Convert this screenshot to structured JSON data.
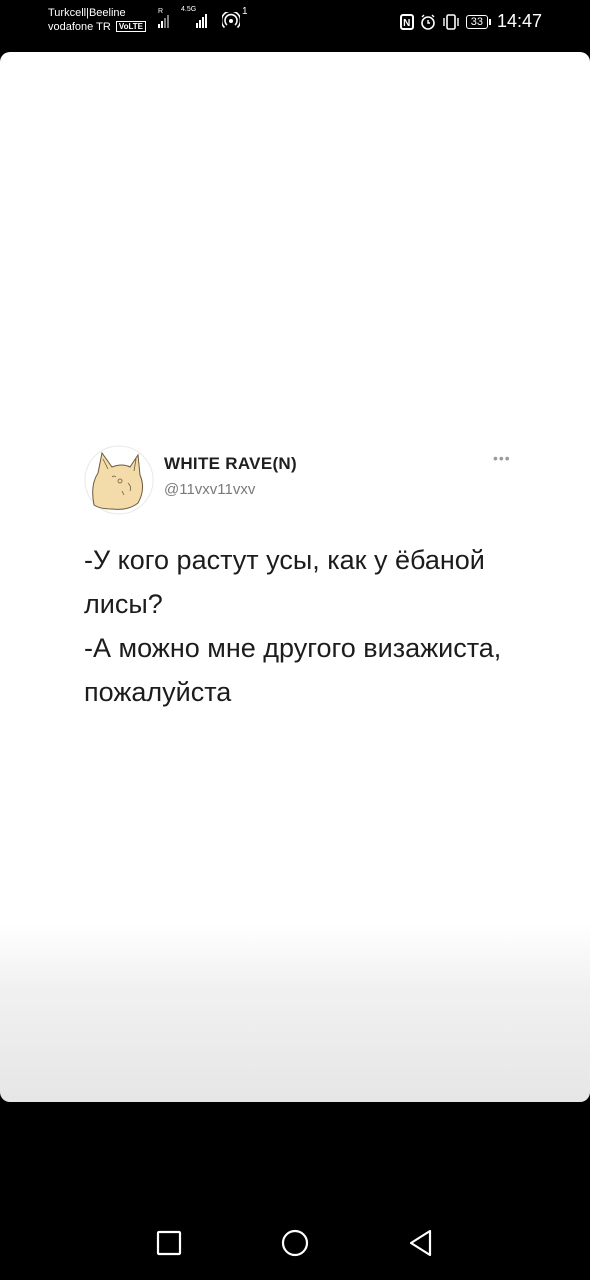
{
  "status_bar": {
    "carrier_line1": "Turkcell|Beeline",
    "carrier_line2": "vodafone TR",
    "volte_badge": "VoLTE",
    "sim1_label": "R",
    "sim2_label": "4.5G",
    "hotspot_count": "1",
    "battery_level": "33",
    "time": "14:47"
  },
  "tweet": {
    "display_name": "WHITE RAVE(N)",
    "handle": "@11vxv11vxv",
    "more_label": "•••",
    "lines": [
      "-У кого растут усы, как у ёбаной лисы?",
      "-А можно мне другого визажиста, пожалуйста"
    ]
  },
  "nav": {
    "recents": "recents-square-icon",
    "home": "home-circle-icon",
    "back": "back-triangle-icon"
  }
}
